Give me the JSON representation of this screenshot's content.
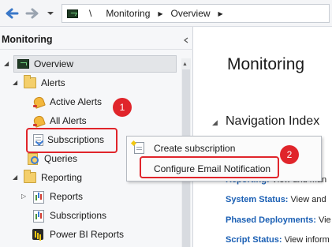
{
  "toolbar": {
    "back_icon": "back-arrow-icon",
    "forward_icon": "forward-arrow-icon",
    "dropdown_icon": "chevron-down-icon",
    "address": {
      "root": "\\",
      "segments": [
        "Monitoring",
        "Overview"
      ]
    }
  },
  "left_pane": {
    "title": "Monitoring",
    "tree": {
      "overview": "Overview",
      "alerts": "Alerts",
      "active_alerts": "Active Alerts",
      "all_alerts": "All Alerts",
      "subscriptions": "Subscriptions",
      "queries": "Queries",
      "reporting": "Reporting",
      "reports": "Reports",
      "reporting_subscriptions": "Subscriptions",
      "power_bi_reports": "Power BI Reports"
    }
  },
  "right_pane": {
    "title": "Monitoring",
    "section": "Navigation Index",
    "lines": [
      {
        "link": "",
        "rest": "ge"
      },
      {
        "link": "Reporting:",
        "rest": " View and man"
      },
      {
        "link": "System Status:",
        "rest": " View and"
      },
      {
        "link": "Phased Deployments:",
        "rest": " Vie"
      },
      {
        "link": "Script Status:",
        "rest": " View inform"
      }
    ]
  },
  "context_menu": {
    "items": [
      {
        "label": "Create subscription",
        "icon": "create-subscription-icon"
      },
      {
        "label": "Configure Email Notification",
        "icon": ""
      }
    ]
  },
  "annotations": {
    "badge_1": "1",
    "badge_2": "2",
    "highlight_color": "#e0252b"
  }
}
